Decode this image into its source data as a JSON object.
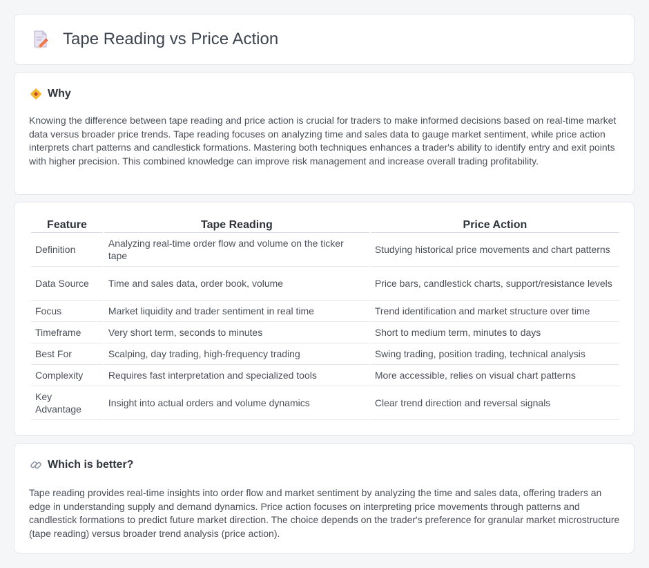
{
  "header": {
    "title": "Tape Reading vs Price Action",
    "icon": "document-edit-icon"
  },
  "why": {
    "icon": "diamond-warning-icon",
    "heading": "Why",
    "text": "Knowing the difference between tape reading and price action is crucial for traders to make informed decisions based on real-time market data versus broader price trends. Tape reading focuses on analyzing time and sales data to gauge market sentiment, while price action interprets chart patterns and candlestick formations. Mastering both techniques enhances a trader's ability to identify entry and exit points with higher precision. This combined knowledge can improve risk management and increase overall trading profitability."
  },
  "table": {
    "headers": [
      "Feature",
      "Tape Reading",
      "Price Action"
    ],
    "rows": [
      [
        "Definition",
        "Analyzing real-time order flow and volume on the ticker tape",
        "Studying historical price movements and chart patterns"
      ],
      [
        "Data Source",
        "Time and sales data, order book, volume",
        "Price bars, candlestick charts, support/resistance levels"
      ],
      [
        "Focus",
        "Market liquidity and trader sentiment in real time",
        "Trend identification and market structure over time"
      ],
      [
        "Timeframe",
        "Very short term, seconds to minutes",
        "Short to medium term, minutes to days"
      ],
      [
        "Best For",
        "Scalping, day trading, high-frequency trading",
        "Swing trading, position trading, technical analysis"
      ],
      [
        "Complexity",
        "Requires fast interpretation and specialized tools",
        "More accessible, relies on visual chart patterns"
      ],
      [
        "Key Advantage",
        "Insight into actual orders and volume dynamics",
        "Clear trend direction and reversal signals"
      ]
    ]
  },
  "better": {
    "icon": "link-icon",
    "heading": "Which is better?",
    "text": "Tape reading provides real-time insights into order flow and market sentiment by analyzing the time and sales data, offering traders an edge in understanding supply and demand dynamics. Price action focuses on interpreting price movements through patterns and candlestick formations to predict future market direction. The choice depends on the trader's preference for granular market microstructure (tape reading) versus broader trend analysis (price action)."
  }
}
